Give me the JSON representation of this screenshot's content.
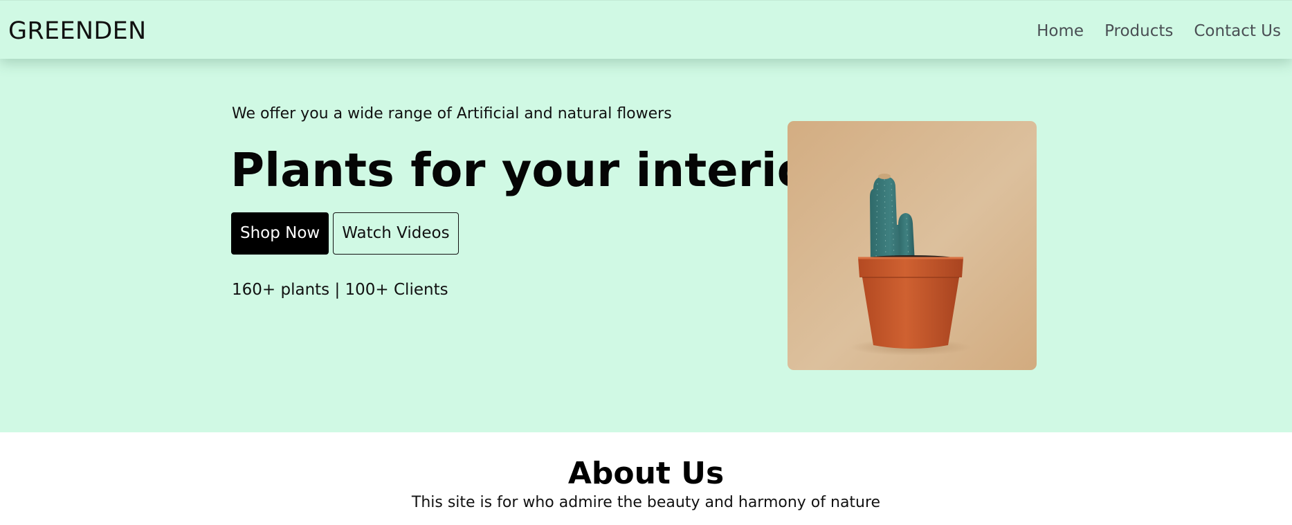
{
  "navbar": {
    "brand": "GREENDEN",
    "links": [
      "Home",
      "Products",
      "Contact Us"
    ]
  },
  "hero": {
    "tagline": "We offer you a wide range of Artificial and natural flowers",
    "headline": "Plants for your interior",
    "primary_button": "Shop Now",
    "secondary_button": "Watch Videos",
    "stats": "160+ plants | 100+ Clients",
    "image": "potted-cactus-photo"
  },
  "about": {
    "title": "About Us",
    "text": "This site is for who admire the beauty and harmony of nature"
  },
  "colors": {
    "hero_background": "#d0f9e4",
    "primary_button": "#000000",
    "nav_link": "#4a4f54",
    "page_background": "#ffffff"
  }
}
